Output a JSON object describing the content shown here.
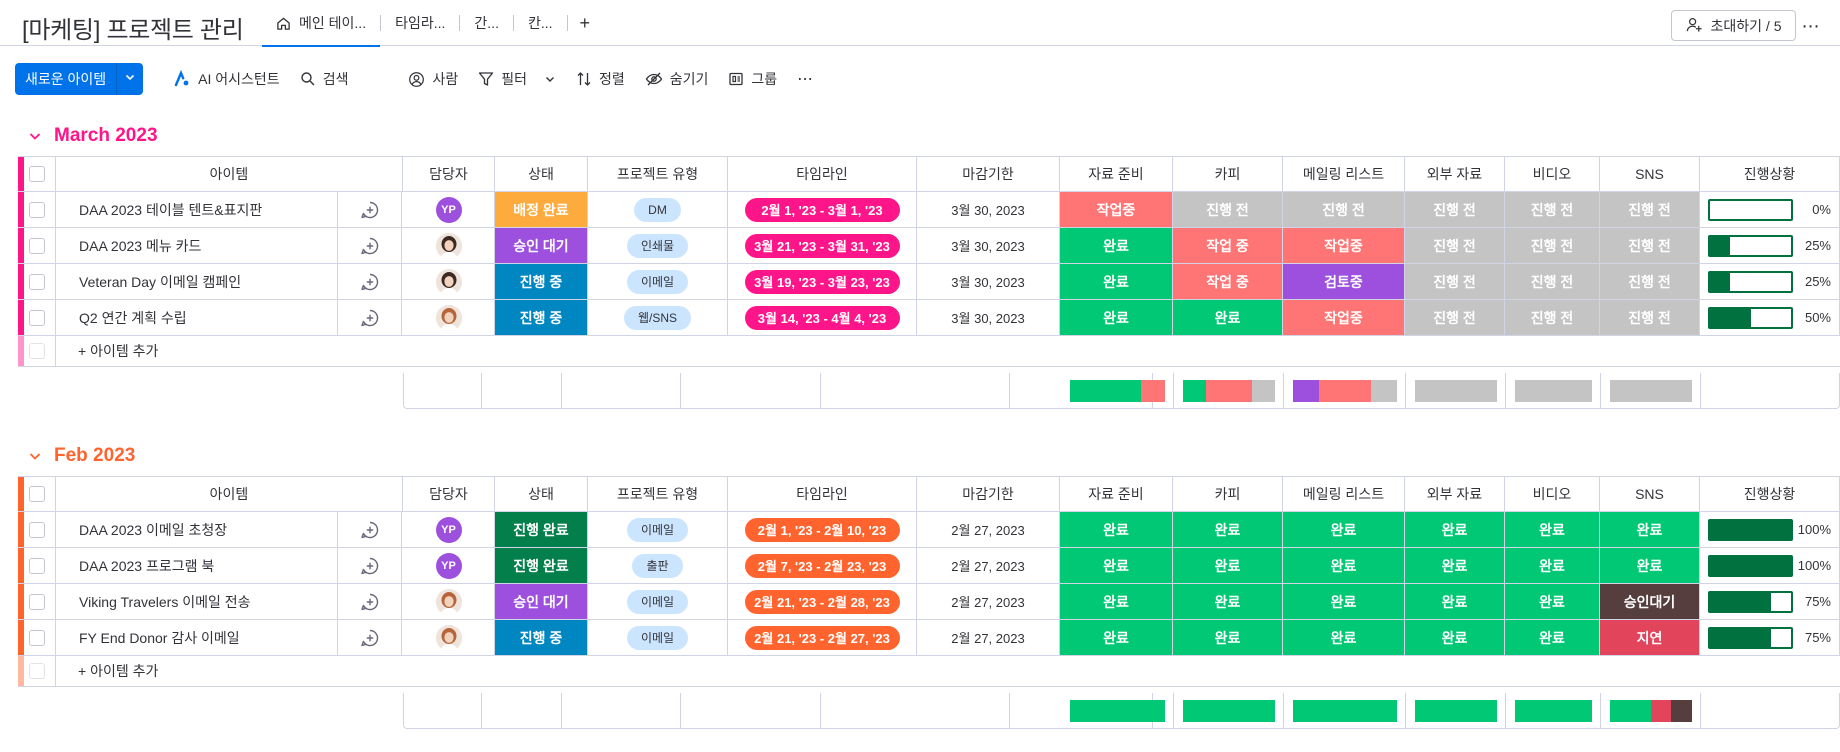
{
  "board": {
    "title": "[마케팅] 프로젝트 관리"
  },
  "tabs": [
    {
      "label": "메인 테이..."
    },
    {
      "label": "타임라..."
    },
    {
      "label": "간..."
    },
    {
      "label": "칸..."
    }
  ],
  "header": {
    "invite_label": "초대하기 / 5",
    "more": "⋯",
    "add_tab": "+"
  },
  "toolbar": {
    "new_item": "새로운 아이템",
    "ai": "AI 어시스턴트",
    "search": "검색",
    "person": "사람",
    "filter": "필터",
    "sort": "정렬",
    "hide": "숨기기",
    "group": "그룹",
    "more": "⋯"
  },
  "columns": [
    "아이템",
    "담당자",
    "상태",
    "프로젝트 유형",
    "타임라인",
    "마감기한",
    "자료 준비",
    "카피",
    "메일링 리스트",
    "외부 자료",
    "비디오",
    "SNS",
    "진행상황"
  ],
  "colors": {
    "done": "#00c875",
    "working": "#fdab3d",
    "stuck": "#ff7575",
    "notstarted": "#c4c4c4",
    "waiting": "#9d50dd",
    "inprogress": "#0086c0",
    "complete": "#037f4c",
    "late": "#e2445c",
    "approvalwait": "#563e3e",
    "march": "#ff158a",
    "feb": "#ff642e"
  },
  "groups": [
    {
      "name": "March 2023",
      "color": "#ff158a",
      "add_label": "+ 아이템 추가",
      "rows": [
        {
          "item": "DAA 2023 테이블 텐트&표지판",
          "owner": "YP",
          "status": "배정 완료",
          "status_color": "#fdab3d",
          "type": "DM",
          "timeline": "2월 1, '23 - 3월 1, '23",
          "deadline": "3월 30, 2023",
          "cells": [
            [
              "작업중",
              "#ff7575"
            ],
            [
              "진행 전",
              "#c4c4c4"
            ],
            [
              "진행 전",
              "#c4c4c4"
            ],
            [
              "진행 전",
              "#c4c4c4"
            ],
            [
              "진행 전",
              "#c4c4c4"
            ],
            [
              "진행 전",
              "#c4c4c4"
            ]
          ],
          "progress": 0,
          "progress_label": "0%"
        },
        {
          "item": "DAA 2023 메뉴 카드",
          "owner": "face",
          "status": "승인 대기",
          "status_color": "#9d50dd",
          "type": "인쇄물",
          "timeline": "3월 21, '23 - 3월 31, '23",
          "deadline": "3월 30, 2023",
          "cells": [
            [
              "완료",
              "#00c875"
            ],
            [
              "작업 중",
              "#ff7575"
            ],
            [
              "작업중",
              "#ff7575"
            ],
            [
              "진행 전",
              "#c4c4c4"
            ],
            [
              "진행 전",
              "#c4c4c4"
            ],
            [
              "진행 전",
              "#c4c4c4"
            ]
          ],
          "progress": 25,
          "progress_label": "25%"
        },
        {
          "item": "Veteran Day 이메일 캠페인",
          "owner": "face",
          "status": "진행 중",
          "status_color": "#0086c0",
          "type": "이메일",
          "timeline": "3월 19, '23 - 3월 23, '23",
          "deadline": "3월 30, 2023",
          "cells": [
            [
              "완료",
              "#00c875"
            ],
            [
              "작업 중",
              "#ff7575"
            ],
            [
              "검토중",
              "#9d50dd"
            ],
            [
              "진행 전",
              "#c4c4c4"
            ],
            [
              "진행 전",
              "#c4c4c4"
            ],
            [
              "진행 전",
              "#c4c4c4"
            ]
          ],
          "progress": 25,
          "progress_label": "25%"
        },
        {
          "item": "Q2 연간 계획 수립",
          "owner": "face2",
          "status": "진행 중",
          "status_color": "#0086c0",
          "type": "웹/SNS",
          "timeline": "3월 14, '23 - 4월 4, '23",
          "deadline": "3월 30, 2023",
          "cells": [
            [
              "완료",
              "#00c875"
            ],
            [
              "완료",
              "#00c875"
            ],
            [
              "작업중",
              "#ff7575"
            ],
            [
              "진행 전",
              "#c4c4c4"
            ],
            [
              "진행 전",
              "#c4c4c4"
            ],
            [
              "진행 전",
              "#c4c4c4"
            ]
          ],
          "progress": 50,
          "progress_label": "50%"
        }
      ],
      "summary": [
        [
          [
            "#00c875",
            0.75
          ],
          [
            "#ff7575",
            0.25
          ]
        ],
        [
          [
            "#00c875",
            0.25
          ],
          [
            "#ff7575",
            0.5
          ],
          [
            "#c4c4c4",
            0.25
          ]
        ],
        [
          [
            "#9d50dd",
            0.25
          ],
          [
            "#ff7575",
            0.5
          ],
          [
            "#c4c4c4",
            0.25
          ]
        ],
        [
          [
            "#c4c4c4",
            1
          ]
        ],
        [
          [
            "#c4c4c4",
            1
          ]
        ],
        [
          [
            "#c4c4c4",
            1
          ]
        ]
      ]
    },
    {
      "name": "Feb 2023",
      "color": "#ff642e",
      "add_label": "+ 아이템 추가",
      "rows": [
        {
          "item": "DAA 2023 이메일 초청장",
          "owner": "YP",
          "status": "진행 완료",
          "status_color": "#037f4c",
          "type": "이메일",
          "timeline": "2월 1, '23 - 2월 10, '23",
          "deadline": "2월 27, 2023",
          "cells": [
            [
              "완료",
              "#00c875"
            ],
            [
              "완료",
              "#00c875"
            ],
            [
              "완료",
              "#00c875"
            ],
            [
              "완료",
              "#00c875"
            ],
            [
              "완료",
              "#00c875"
            ],
            [
              "완료",
              "#00c875"
            ]
          ],
          "progress": 100,
          "progress_label": "100%"
        },
        {
          "item": "DAA 2023 프로그램 북",
          "owner": "YP",
          "status": "진행 완료",
          "status_color": "#037f4c",
          "type": "출판",
          "timeline": "2월 7, '23 - 2월 23, '23",
          "deadline": "2월 27, 2023",
          "cells": [
            [
              "완료",
              "#00c875"
            ],
            [
              "완료",
              "#00c875"
            ],
            [
              "완료",
              "#00c875"
            ],
            [
              "완료",
              "#00c875"
            ],
            [
              "완료",
              "#00c875"
            ],
            [
              "완료",
              "#00c875"
            ]
          ],
          "progress": 100,
          "progress_label": "100%"
        },
        {
          "item": "Viking Travelers 이메일 전송",
          "owner": "face2",
          "status": "승인 대기",
          "status_color": "#9d50dd",
          "type": "이메일",
          "timeline": "2월 21, '23 - 2월 28, '23",
          "deadline": "2월 27, 2023",
          "cells": [
            [
              "완료",
              "#00c875"
            ],
            [
              "완료",
              "#00c875"
            ],
            [
              "완료",
              "#00c875"
            ],
            [
              "완료",
              "#00c875"
            ],
            [
              "완료",
              "#00c875"
            ],
            [
              "승인대기",
              "#563e3e"
            ]
          ],
          "progress": 75,
          "progress_label": "75%"
        },
        {
          "item": "FY End Donor 감사 이메일",
          "owner": "face2",
          "status": "진행 중",
          "status_color": "#0086c0",
          "type": "이메일",
          "timeline": "2월 21, '23 - 2월 27, '23",
          "deadline": "2월 27, 2023",
          "cells": [
            [
              "완료",
              "#00c875"
            ],
            [
              "완료",
              "#00c875"
            ],
            [
              "완료",
              "#00c875"
            ],
            [
              "완료",
              "#00c875"
            ],
            [
              "완료",
              "#00c875"
            ],
            [
              "지연",
              "#e2445c"
            ]
          ],
          "progress": 75,
          "progress_label": "75%"
        }
      ],
      "summary": [
        [
          [
            "#00c875",
            1
          ]
        ],
        [
          [
            "#00c875",
            1
          ]
        ],
        [
          [
            "#00c875",
            1
          ]
        ],
        [
          [
            "#00c875",
            1
          ]
        ],
        [
          [
            "#00c875",
            1
          ]
        ],
        [
          [
            "#00c875",
            0.5
          ],
          [
            "#e2445c",
            0.25
          ],
          [
            "#563e3e",
            0.25
          ]
        ]
      ]
    }
  ]
}
